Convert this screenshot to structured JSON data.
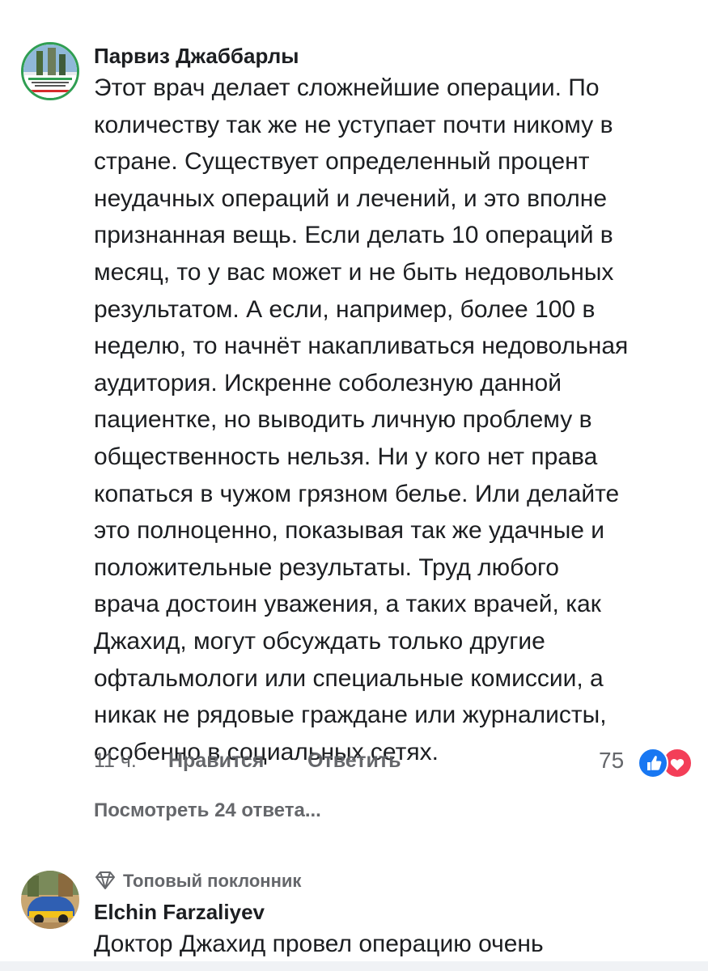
{
  "comment1": {
    "author": "Парвиз Джаббарлы",
    "text_lines": [
      "Этот врач делает сложнейшие операции. По",
      "количеству так же не уступает почти никому в",
      "стране. Существует определенный процент",
      "неудачных операций и лечений, и это вполне",
      "признанная вещь. Если делать 10 операций в",
      "месяц, то у вас может и не быть недовольных",
      "результатом. А если, например, более 100 в",
      "неделю, то начнёт накапливаться недовольная",
      "аудитория. Искренне соболезную данной",
      "пациентке, но выводить личную проблему в",
      "общественность нельзя. Ни у кого нет права",
      "копаться в чужом грязном белье. Или делайте",
      "это полноценно, показывая так же удачные и",
      "положительные результаты. Труд любого",
      "врача достоин уважения, а таких врачей, как",
      "Джахид, могут обсуждать только другие",
      "офтальмологи или специальные комиссии, а",
      "никак не рядовые граждане или журналисты,",
      "особенно в социальных сетях."
    ],
    "time": "11 ч.",
    "like_label": "Нравится",
    "reply_label": "Ответить",
    "reaction_count": "75",
    "reaction_icons": [
      "like-icon",
      "love-icon"
    ],
    "view_replies": "Посмотреть 24 ответа..."
  },
  "comment2": {
    "badge_icon": "diamond-icon",
    "badge_label": "Топовый поклонник",
    "author": "Elchin Farzaliyev",
    "text_lines": [
      "Доктор Джахид провел операцию очень"
    ]
  },
  "colors": {
    "text": "#1c1e21",
    "secondary": "#65676b",
    "like_blue": "#1877f2",
    "love_red": "#f33e58"
  }
}
